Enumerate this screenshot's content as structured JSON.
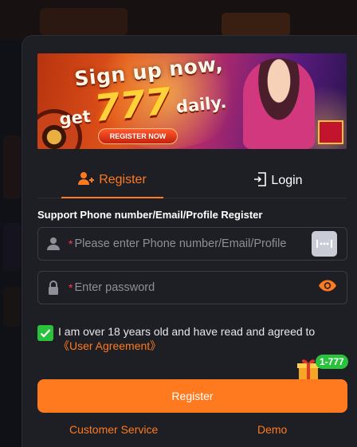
{
  "banner": {
    "headline_1": "Sign up now,",
    "headline_2_pre": "get",
    "headline_2_num": "777",
    "headline_2_post": "daily.",
    "cta": "REGISTER NOW"
  },
  "tabs": {
    "register": "Register",
    "login": "Login"
  },
  "form": {
    "title": "Support Phone number/Email/Profile Register",
    "account": {
      "required_mark": "*",
      "placeholder": "Please enter Phone number/Email/Profile"
    },
    "password": {
      "required_mark": "*",
      "placeholder": "Enter password"
    },
    "agreement": {
      "checked": true,
      "text": "I am over 18 years old and have read and agreed to ",
      "link": "《User Agreement》"
    },
    "promo_badge": "1-777",
    "submit": "Register"
  },
  "footer": {
    "customer_service": "Customer Service",
    "demo": "Demo"
  },
  "colors": {
    "accent": "#ff7a1f",
    "check": "#2ac13c",
    "required": "#ff3b4f",
    "panel": "#1e1f25"
  },
  "icons": {
    "register_tab": "add-user-icon",
    "login_tab": "login-door-icon",
    "account": "user-icon",
    "password": "lock-icon",
    "keyboard": "keyboard-dots-icon",
    "visibility": "eye-icon",
    "promo": "gift-icon"
  }
}
